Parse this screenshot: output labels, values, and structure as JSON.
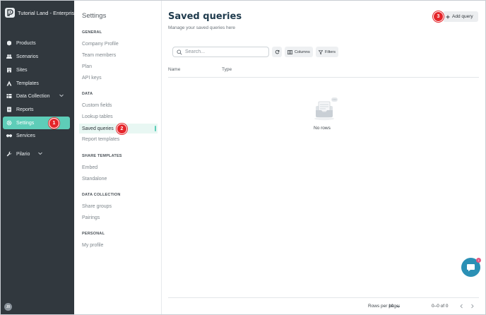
{
  "app": {
    "org_name": "Tutorial Land - Enterpris"
  },
  "nav": {
    "items": [
      {
        "label": "Products",
        "icon": "box-icon"
      },
      {
        "label": "Scenarios",
        "icon": "people-icon"
      },
      {
        "label": "Sites",
        "icon": "building-icon"
      },
      {
        "label": "Templates",
        "icon": "template-icon"
      },
      {
        "label": "Data Collection",
        "icon": "table-icon"
      },
      {
        "label": "Reports",
        "icon": "report-icon"
      },
      {
        "label": "Settings",
        "icon": "gear-icon"
      },
      {
        "label": "Services",
        "icon": "handshake-icon"
      },
      {
        "label": "Pilario",
        "icon": "wrench-icon"
      }
    ],
    "avatar_initials": "JB",
    "active_color": "#5ecdb8"
  },
  "settings_menu": {
    "title": "Settings",
    "sections": [
      {
        "heading": "GENERAL",
        "items": [
          "Company Profile",
          "Team members",
          "Plan",
          "API keys"
        ]
      },
      {
        "heading": "DATA",
        "items": [
          "Custom fields",
          "Lookup tables",
          "Saved queries",
          "Report templates"
        ]
      },
      {
        "heading": "SHARE TEMPLATES",
        "items": [
          "Embed",
          "Standalone"
        ]
      },
      {
        "heading": "DATA COLLECTION",
        "items": [
          "Share groups",
          "Pairings"
        ]
      },
      {
        "heading": "PERSONAL",
        "items": [
          "My profile"
        ]
      }
    ],
    "active_item": "Saved queries"
  },
  "main": {
    "title": "Saved queries",
    "subtitle": "Manage your saved queries here",
    "add_button": "Add query",
    "search_placeholder": "Search...",
    "columns_button": "Columns",
    "filters_button": "Filters",
    "table_headers": [
      "Name",
      "Type"
    ],
    "empty_text": "No rows",
    "rows_per_page_label": "Rows per page:",
    "rows_per_page_value": "10",
    "range_text": "0–0 of 0"
  },
  "chat": {
    "badge": "1"
  },
  "markers": [
    "1",
    "2",
    "3"
  ],
  "colors": {
    "nav_bg": "#31383e",
    "accent": "#5ecdb8",
    "title": "#1f3b4d",
    "marker": "#e5252a",
    "chat": "#2b90b5"
  }
}
